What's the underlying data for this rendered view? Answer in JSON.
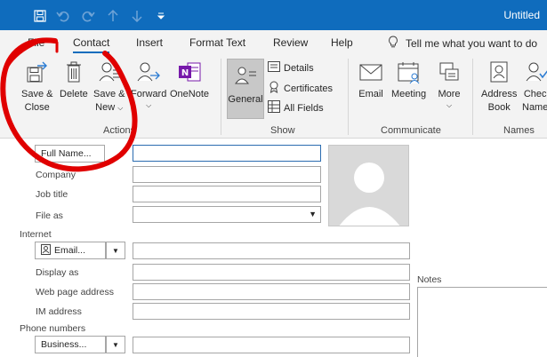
{
  "window": {
    "title": "Untitled"
  },
  "qat": [
    {
      "name": "save-icon"
    },
    {
      "name": "undo-icon"
    },
    {
      "name": "redo-icon"
    },
    {
      "name": "up-arrow-icon"
    },
    {
      "name": "down-arrow-icon"
    },
    {
      "name": "customize-icon"
    }
  ],
  "tabs": [
    "File",
    "Contact",
    "Insert",
    "Format Text",
    "Review",
    "Help"
  ],
  "active_tab": "Contact",
  "tell_me": "Tell me what you want to do",
  "ribbon": {
    "actions": {
      "label": "Actions",
      "save_close": [
        "Save &",
        "Close"
      ],
      "delete": "Delete",
      "save_new": [
        "Save &",
        "New"
      ],
      "forward": "Forward",
      "onenote": "OneNote"
    },
    "show": {
      "label": "Show",
      "general": "General",
      "details": "Details",
      "certificates": "Certificates",
      "all_fields": "All Fields"
    },
    "communicate": {
      "label": "Communicate",
      "email": "Email",
      "meeting": "Meeting",
      "more": "More"
    },
    "names": {
      "label": "Names",
      "address_book": [
        "Address",
        "Book"
      ],
      "check_names": [
        "Check",
        "Names"
      ]
    }
  },
  "form": {
    "full_name_btn": "Full Name...",
    "company": "Company",
    "job_title": "Job title",
    "file_as": "File as",
    "internet": "Internet",
    "email_btn": "Email...",
    "display_as": "Display as",
    "web_page": "Web page address",
    "im_address": "IM address",
    "phone_numbers": "Phone numbers",
    "business_btn": "Business...",
    "notes": "Notes"
  },
  "colors": {
    "title_bar": "#0f6cbd",
    "annotation": "#e00000"
  }
}
